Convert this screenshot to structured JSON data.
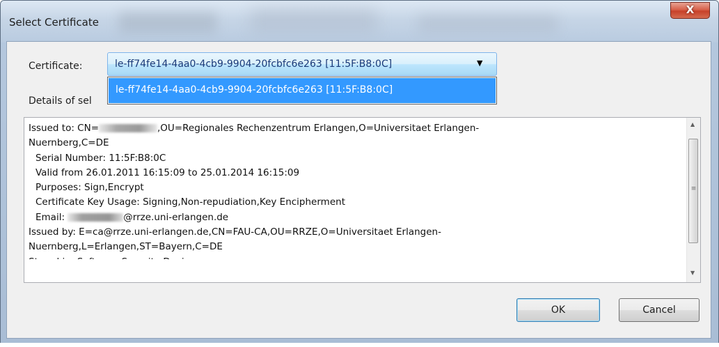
{
  "window": {
    "title": "Select Certificate",
    "close_glyph": "X"
  },
  "certificate": {
    "label": "Certificate:",
    "selected": "le-ff74fe14-4aa0-4cb9-9904-20fcbfc6e263 [11:5F:B8:0C]",
    "options": [
      "le-ff74fe14-4aa0-4cb9-9904-20fcbfc6e263 [11:5F:B8:0C]"
    ],
    "dropdown_open": true
  },
  "details": {
    "label": "Details of sel",
    "lines": {
      "issued_to_prefix": "Issued to: CN=",
      "issued_to_rest": ",OU=Regionales Rechenzentrum Erlangen,O=Universitaet Erlangen-",
      "issued_to_cont": "Nuernberg,C=DE",
      "serial": "Serial Number: 11:5F:B8:0C",
      "valid": "Valid from 26.01.2011 16:15:09 to 25.01.2014 16:15:09",
      "purposes": "Purposes: Sign,Encrypt",
      "key_usage": "Certificate Key Usage: Signing,Non-repudiation,Key Encipherment",
      "email_prefix": "Email: ",
      "email_domain": "@rrze.uni-erlangen.de",
      "issued_by": "Issued by: E=ca@rrze.uni-erlangen.de,CN=FAU-CA,OU=RRZE,O=Universitaet Erlangen-",
      "issued_by_cont": "Nuernberg,L=Erlangen,ST=Bayern,C=DE",
      "partial": "Stored in: Software Security Device"
    }
  },
  "buttons": {
    "ok": "OK",
    "cancel": "Cancel"
  },
  "icons": {
    "dropdown_arrow": "▼",
    "scroll_up": "▲",
    "scroll_down": "▼",
    "scroll_grip": "≡"
  }
}
